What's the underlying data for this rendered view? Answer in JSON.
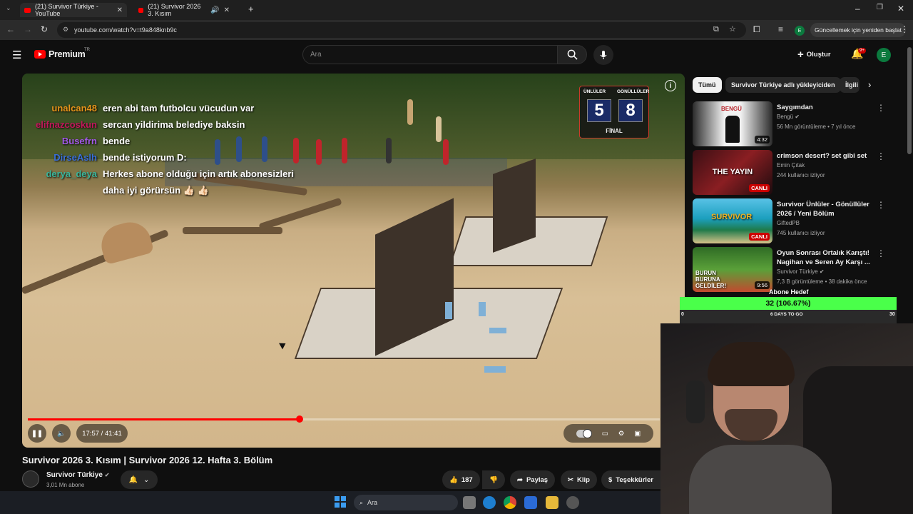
{
  "browser": {
    "tabs": [
      {
        "title": "(21) Survivor Türkiye - YouTube"
      },
      {
        "title": "(21) Survivor 2026 3. Kısım"
      }
    ],
    "url": "youtube.com/watch?v=t9a848knb9c",
    "update_label": "Güncellemek için yeniden başlat",
    "profile_letter": "E"
  },
  "header": {
    "logo_text": "Premium",
    "logo_region": "TR",
    "search_placeholder": "Ara",
    "create_label": "Oluştur",
    "notif_count": "9+",
    "avatar_letter": "E"
  },
  "video": {
    "chat": [
      {
        "user": "unalcan48",
        "msg": "eren abi tam futbolcu vücudun var",
        "color": "#e8941a"
      },
      {
        "user": "elifnazcoskun",
        "msg": "sercan yildirima belediye baksin",
        "color": "#c2185b"
      },
      {
        "user": "Busefrn",
        "msg": "bende",
        "color": "#a259e6"
      },
      {
        "user": "DirseAslh",
        "msg": "bende istiyorum D:",
        "color": "#3a6fd8"
      },
      {
        "user": "derya_deya",
        "msg": "Herkes abone olduğu için artık abonesizleri",
        "color": "#3bb59b"
      },
      {
        "user": "",
        "msg": "daha iyi görürsün 👍🏻 👍🏻",
        "color": "#ffffff"
      }
    ],
    "scoreboard": {
      "left_label": "ÜNLÜLER",
      "right_label": "GÖNÜLLÜLER",
      "left_score": "5",
      "right_score": "8",
      "stage": "FİNAL"
    },
    "time": "17:57 / 41:41",
    "progress": 0.43,
    "title": "Survivor 2026 3. Kısım | Survivor 2026 12. Hafta 3. Bölüm",
    "channel": "Survivor Türkiye",
    "subscribers": "3,01 Mn abone",
    "likes": "187",
    "share_label": "Paylaş",
    "clip_label": "Klip",
    "thanks_label": "Teşekkürler"
  },
  "sidebar": {
    "chips": [
      "Tümü",
      "Survivor Türkiye adlı yükleyiciden",
      "İlgili"
    ],
    "recommendations": [
      {
        "title": "Saygımdan",
        "channel": "Bengü",
        "meta": "56 Mn görüntüleme • 7 yıl önce",
        "badge": "4:32",
        "thumb_text": "BENGÜ"
      },
      {
        "title": "crimson desert? set gibi set",
        "channel": "Emin Çıtak",
        "meta": "244 kullanıcı izliyor",
        "badge": "CANLI",
        "thumb_text": "THE YAYIN"
      },
      {
        "title": "Survivor Ünlüler - Gönüllüler 2026 / Yeni Bölüm",
        "channel": "GiftedPB",
        "meta": "745 kullanıcı izliyor",
        "badge": "CANLI",
        "thumb_text": "SURVIVOR"
      },
      {
        "title": "Oyun Sonrası Ortalık Karıştı! Nagihan ve Seren Ay Karşı ...",
        "channel": "Survivor Türkiye",
        "meta": "7,3 B görüntüleme • 38 dakika önce",
        "badge": "9:56",
        "thumb_text": "BURUN BURUNA GELDİLER!"
      }
    ]
  },
  "overlay": {
    "abone_title": "Abone Hedef",
    "abone_value": "32 (106.67%)",
    "abone_progress": 1.0,
    "days_label": "6 DAYS TO GO",
    "left_num": "0",
    "right_num": "30"
  },
  "taskbar": {
    "search_label": "Ara"
  }
}
